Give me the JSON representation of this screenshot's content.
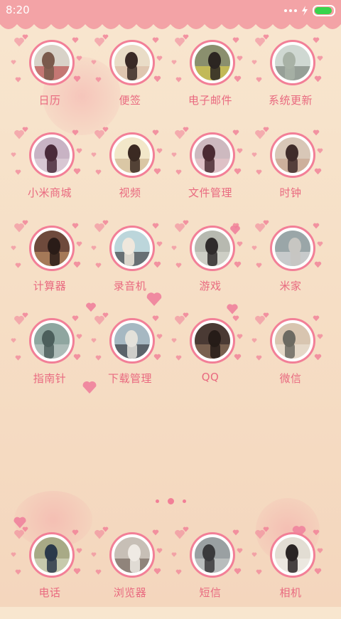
{
  "status_bar": {
    "time": "8:20",
    "battery_level": 1.0
  },
  "colors": {
    "status_bar": "#f3a3a6",
    "accent": "#f27f97",
    "label": "#e96a80",
    "background": "#f7e3cb"
  },
  "apps": [
    {
      "label": "日历",
      "icon": "calendar-photo-icon"
    },
    {
      "label": "便签",
      "icon": "notes-photo-icon"
    },
    {
      "label": "电子邮件",
      "icon": "email-photo-icon"
    },
    {
      "label": "系统更新",
      "icon": "updater-photo-icon"
    },
    {
      "label": "小米商城",
      "icon": "mi-store-photo-icon"
    },
    {
      "label": "视频",
      "icon": "video-photo-icon"
    },
    {
      "label": "文件管理",
      "icon": "file-manager-photo-icon"
    },
    {
      "label": "时钟",
      "icon": "clock-photo-icon"
    },
    {
      "label": "计算器",
      "icon": "calculator-photo-icon"
    },
    {
      "label": "录音机",
      "icon": "recorder-photo-icon"
    },
    {
      "label": "游戏",
      "icon": "games-photo-icon"
    },
    {
      "label": "米家",
      "icon": "mijia-photo-icon"
    },
    {
      "label": "指南针",
      "icon": "compass-photo-icon"
    },
    {
      "label": "下载管理",
      "icon": "downloads-photo-icon"
    },
    {
      "label": "QQ",
      "icon": "qq-photo-icon"
    },
    {
      "label": "微信",
      "icon": "wechat-photo-icon"
    }
  ],
  "dock": [
    {
      "label": "电话",
      "icon": "phone-photo-icon"
    },
    {
      "label": "浏览器",
      "icon": "browser-photo-icon"
    },
    {
      "label": "短信",
      "icon": "messages-photo-icon"
    },
    {
      "label": "相机",
      "icon": "camera-photo-icon"
    }
  ],
  "pages": {
    "count": 3,
    "current": 2
  }
}
